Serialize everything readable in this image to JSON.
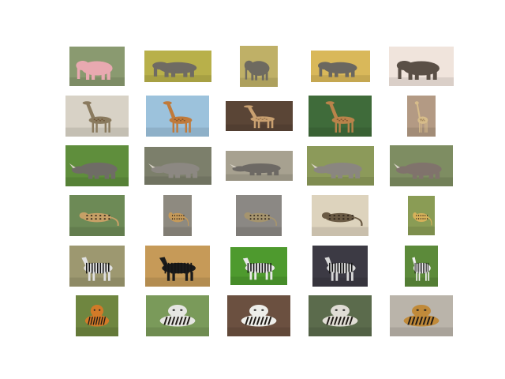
{
  "gallery": {
    "rows": [
      {
        "subject": "elephant",
        "tiles": [
          {
            "name": "elephant-pink-calf-photo",
            "bg": "#8a9a70",
            "fg": "#e8a9b0"
          },
          {
            "name": "elephant-herd-photo",
            "bg": "#b8b04a",
            "fg": "#6f6b63"
          },
          {
            "name": "elephant-frontal-photo",
            "bg": "#bfb067",
            "fg": "#6e6a60"
          },
          {
            "name": "elephant-lying-photo",
            "bg": "#d9b85a",
            "fg": "#6a6760"
          },
          {
            "name": "elephant-dust-photo",
            "bg": "#f0e4dc",
            "fg": "#5a4f46"
          }
        ]
      },
      {
        "subject": "giraffe",
        "tiles": [
          {
            "name": "giraffe-savanna-photo",
            "bg": "#d8d2c6",
            "fg": "#8a7a5e"
          },
          {
            "name": "giraffe-head-photo",
            "bg": "#9cc2dc",
            "fg": "#c07a3a"
          },
          {
            "name": "giraffe-dark-photo",
            "bg": "#5a4536",
            "fg": "#c9a070"
          },
          {
            "name": "giraffe-group-photo",
            "bg": "#3f6b3a",
            "fg": "#b9834a"
          },
          {
            "name": "giraffe-standing-photo",
            "bg": "#b39a84",
            "fg": "#d7bc8a"
          }
        ]
      },
      {
        "subject": "rhinoceros",
        "tiles": [
          {
            "name": "rhino-grass-photo",
            "bg": "#5f8e3c",
            "fg": "#6f6c66"
          },
          {
            "name": "rhino-closeup-photo",
            "bg": "#7c7f6b",
            "fg": "#8c8882"
          },
          {
            "name": "rhino-profile-photo",
            "bg": "#a7a190",
            "fg": "#6d6964"
          },
          {
            "name": "rhino-mud-photo",
            "bg": "#8c9a5a",
            "fg": "#8a8680"
          },
          {
            "name": "rhino-calf-photo",
            "bg": "#7e8d62",
            "fg": "#80736c"
          }
        ]
      },
      {
        "subject": "leopard",
        "tiles": [
          {
            "name": "leopard-tree-photo",
            "bg": "#6d8a56",
            "fg": "#c7a066"
          },
          {
            "name": "leopard-rock-photo",
            "bg": "#8e8a80",
            "fg": "#c59a5a"
          },
          {
            "name": "leopard-hidden-photo",
            "bg": "#8b8884",
            "fg": "#a5946e"
          },
          {
            "name": "leopard-sign-photo",
            "bg": "#ddd3bd",
            "fg": "#6a5a44",
            "caption": ""
          },
          {
            "name": "leopard-portrait-photo",
            "bg": "#8a9c55",
            "fg": "#d6b15a"
          }
        ]
      },
      {
        "subject": "zebra",
        "tiles": [
          {
            "name": "zebra-field-photo",
            "bg": "#9d9870",
            "fg": "#e0e0e0"
          },
          {
            "name": "zebra-pair-photo",
            "bg": "#c69a58",
            "fg": "#1b1b1b"
          },
          {
            "name": "zebra-lying-photo",
            "bg": "#4e9a2e",
            "fg": "#e9e9e9",
            "caption": ""
          },
          {
            "name": "zebra-enclosure-photo",
            "bg": "#3c3a44",
            "fg": "#d8d8d8"
          },
          {
            "name": "zebra-standing-photo",
            "bg": "#5c8a3a",
            "fg": "#f2f2f2"
          }
        ]
      },
      {
        "subject": "tiger",
        "tiles": [
          {
            "name": "tiger-orange-photo",
            "bg": "#6f8640",
            "fg": "#d27a28"
          },
          {
            "name": "white-tiger-face-photo",
            "bg": "#7a9a5a",
            "fg": "#e6e6e2"
          },
          {
            "name": "white-tiger-walking-photo",
            "bg": "#6b5040",
            "fg": "#eeeeea"
          },
          {
            "name": "white-tiger-grass-photo",
            "bg": "#5b6b4c",
            "fg": "#e0ddd5"
          },
          {
            "name": "tigers-with-monk-photo",
            "bg": "#bab4aa",
            "fg": "#c08a3a"
          }
        ]
      }
    ]
  }
}
